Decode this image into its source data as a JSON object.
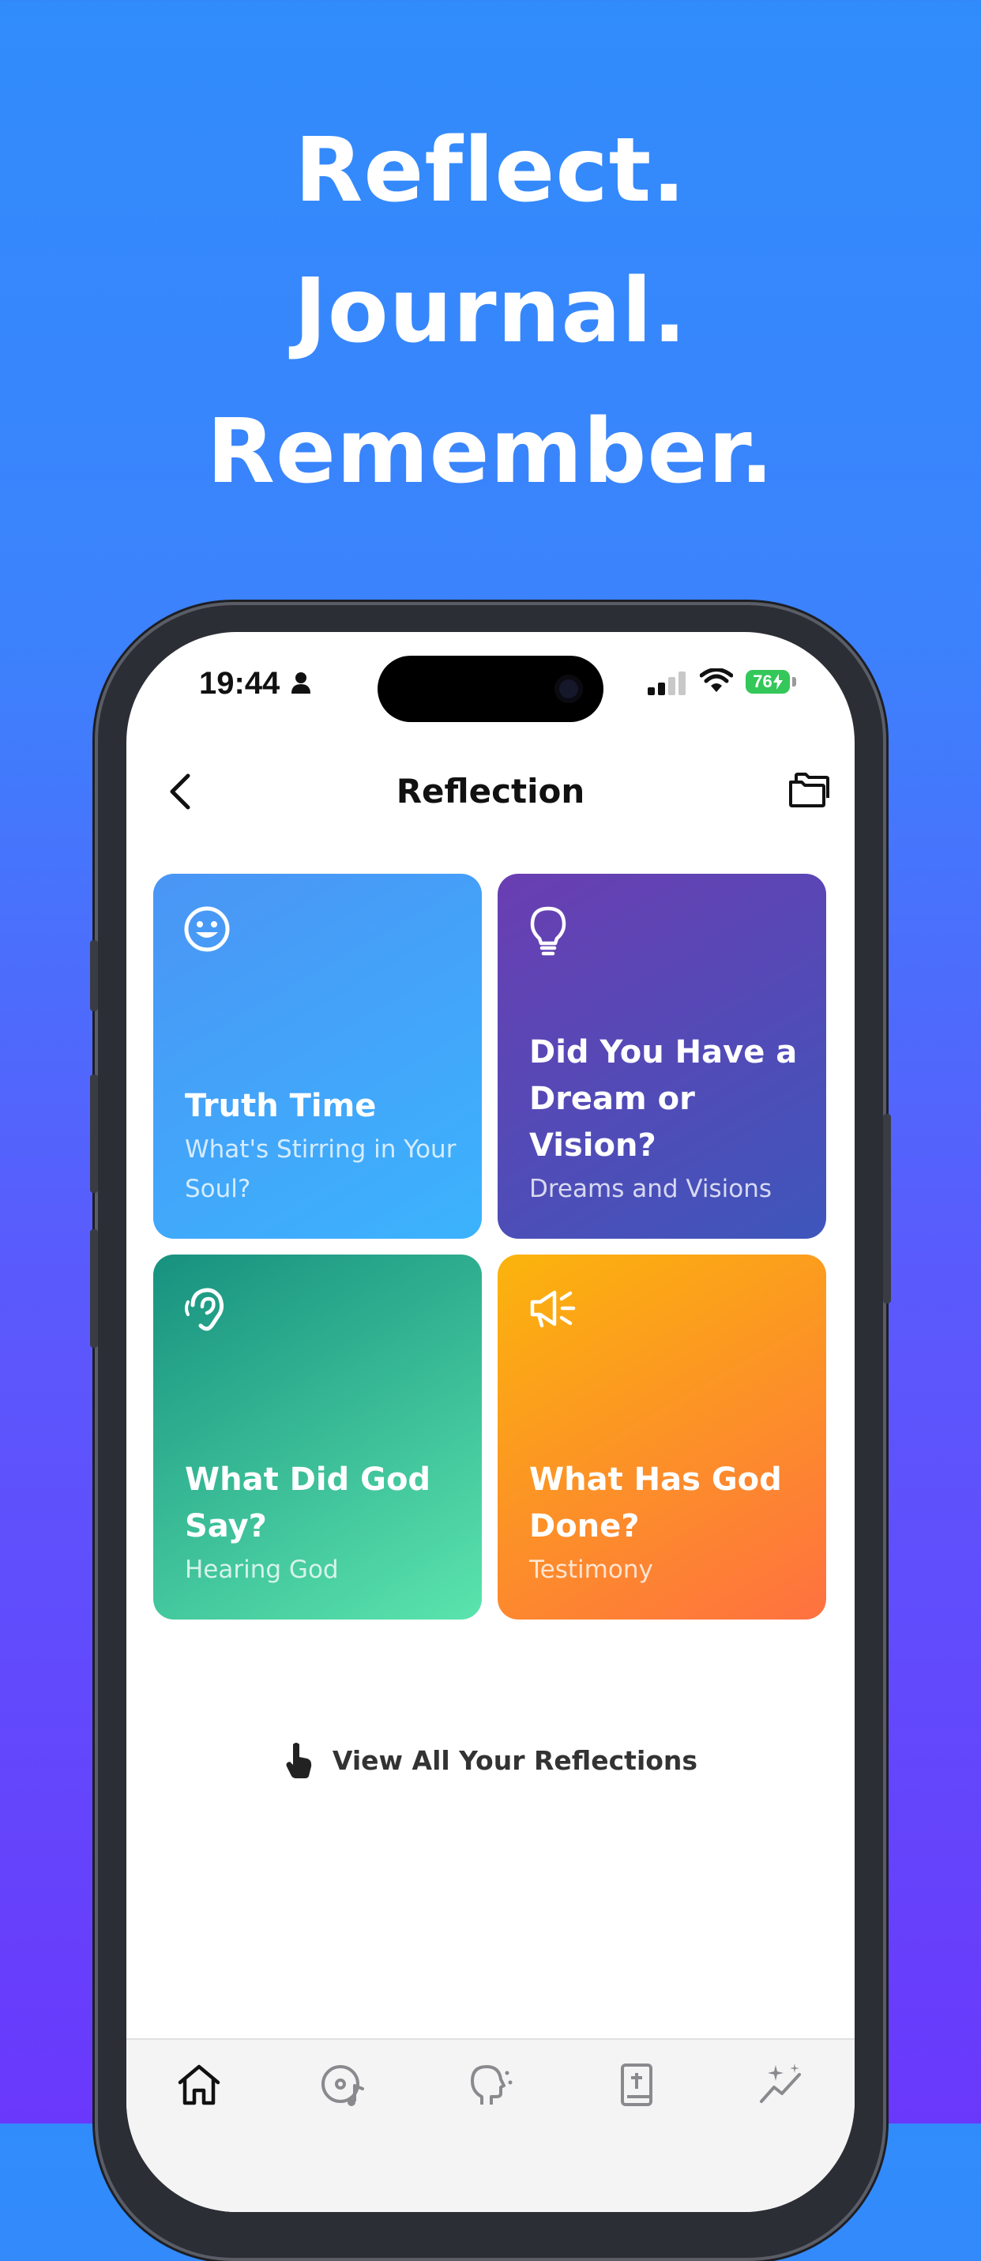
{
  "headline": {
    "line1": "Reflect.",
    "line2": "Journal.",
    "line3": "Remember."
  },
  "status_bar": {
    "time": "19:44",
    "battery": "76"
  },
  "nav": {
    "title": "Reflection",
    "back_icon": "chevron-left-icon",
    "folder_icon": "folders-icon"
  },
  "cards": [
    {
      "title": "Truth Time",
      "subtitle": "What's Stirring in Your Soul?",
      "icon": "smiley-icon"
    },
    {
      "title": "Did You Have a Dream or Vision?",
      "subtitle": "Dreams and Visions",
      "icon": "lightbulb-icon"
    },
    {
      "title": "What Did God Say?",
      "subtitle": "Hearing God",
      "icon": "ear-icon"
    },
    {
      "title": "What Has God Done?",
      "subtitle": "Testimony",
      "icon": "megaphone-icon"
    }
  ],
  "view_all": {
    "label": "View All Your Reflections",
    "icon": "pointing-hand-icon"
  },
  "tabs": [
    {
      "icon": "home-icon",
      "active": true
    },
    {
      "icon": "music-disc-icon"
    },
    {
      "icon": "head-thinking-icon"
    },
    {
      "icon": "bible-icon"
    },
    {
      "icon": "sparkle-chart-icon"
    }
  ],
  "colors": {
    "bg_top": "#318cfb",
    "bg_bottom": "#6a38fb",
    "battery": "#34c759"
  }
}
